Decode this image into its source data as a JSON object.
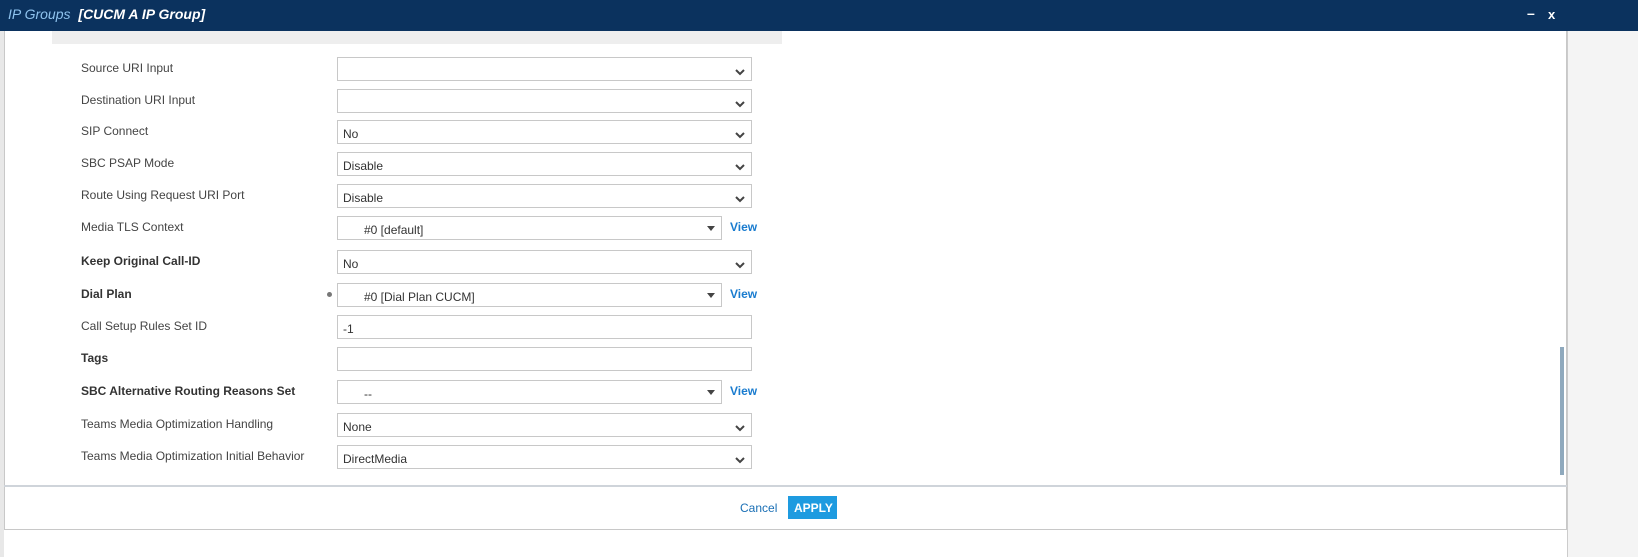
{
  "header": {
    "section": "IP Groups",
    "item": "[CUCM A IP Group]",
    "minimize": "–",
    "close": "x"
  },
  "fields": [
    {
      "label": "Source URI Input",
      "value": "",
      "bold": false
    },
    {
      "label": "Destination URI Input",
      "value": "",
      "bold": false
    },
    {
      "label": "SIP Connect",
      "value": "No",
      "bold": false
    },
    {
      "label": "SBC PSAP Mode",
      "value": "Disable",
      "bold": false
    },
    {
      "label": "Route Using Request URI Port",
      "value": "Disable",
      "bold": false
    },
    {
      "label": "Media TLS Context",
      "value": "#0 [default]",
      "bold": false,
      "view": "View"
    },
    {
      "label": "Keep Original Call-ID",
      "value": "No",
      "bold": true
    },
    {
      "label": "Dial Plan",
      "value": "#0 [Dial Plan CUCM]",
      "bold": true,
      "view": "View",
      "modified": true
    },
    {
      "label": "Call Setup Rules Set ID",
      "value": "-1",
      "bold": false,
      "input": true
    },
    {
      "label": "Tags",
      "value": "",
      "bold": true,
      "input": true
    },
    {
      "label": "SBC Alternative Routing Reasons Set",
      "value": "--",
      "bold": true,
      "view": "View"
    },
    {
      "label": "Teams Media Optimization Handling",
      "value": "None",
      "bold": false
    },
    {
      "label": "Teams Media Optimization Initial Behavior",
      "value": "DirectMedia",
      "bold": false
    }
  ],
  "footer": {
    "cancel": "Cancel",
    "apply": "APPLY"
  }
}
